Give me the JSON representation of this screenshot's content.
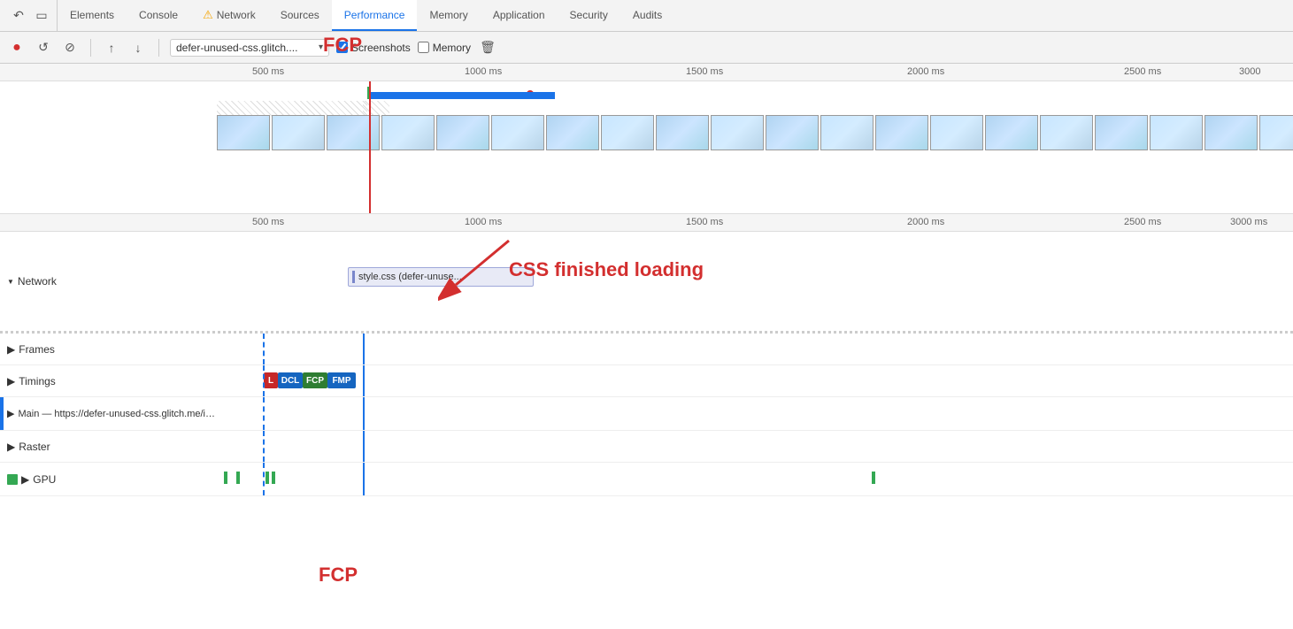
{
  "tabs": {
    "icons": [
      "cursor",
      "square"
    ],
    "items": [
      {
        "label": "Elements",
        "active": false
      },
      {
        "label": "Console",
        "active": false
      },
      {
        "label": "Network",
        "active": false,
        "warn": true
      },
      {
        "label": "Sources",
        "active": false
      },
      {
        "label": "Performance",
        "active": true
      },
      {
        "label": "Memory",
        "active": false
      },
      {
        "label": "Application",
        "active": false
      },
      {
        "label": "Security",
        "active": false
      },
      {
        "label": "Audits",
        "active": false
      }
    ]
  },
  "toolbar": {
    "record_label": "●",
    "refresh_label": "↻",
    "stop_label": "⊘",
    "upload_label": "↑",
    "download_label": "↓",
    "url_text": "defer-unused-css.glitch....",
    "screenshots_label": "Screenshots",
    "memory_label": "Memory",
    "trash_label": "🗑"
  },
  "timeline": {
    "markers": [
      "500 ms",
      "1000 ms",
      "1500 ms",
      "2000 ms",
      "2500 ms",
      "3000"
    ],
    "markers_bottom": [
      "500 ms",
      "1000 ms",
      "1500 ms",
      "2000 ms",
      "2500 ms",
      "3000 ms"
    ]
  },
  "network_section": {
    "label": "Network",
    "style_css_label": "style.css (defer-unuse..."
  },
  "annotation": {
    "css_text": "CSS finished loading",
    "fcp_text": "FCP"
  },
  "rows": [
    {
      "label": "Frames",
      "triangle": "▶"
    },
    {
      "label": "Timings",
      "triangle": "▶"
    },
    {
      "label": "Main — https://defer-unused-css.glitch.me/index-optimized.html",
      "triangle": "▶"
    },
    {
      "label": "Raster",
      "triangle": "▶"
    },
    {
      "label": "GPU",
      "triangle": "▶"
    }
  ],
  "timings": {
    "l": "L",
    "dcl": "DCL",
    "fcp": "FCP",
    "fmp": "FMP"
  }
}
